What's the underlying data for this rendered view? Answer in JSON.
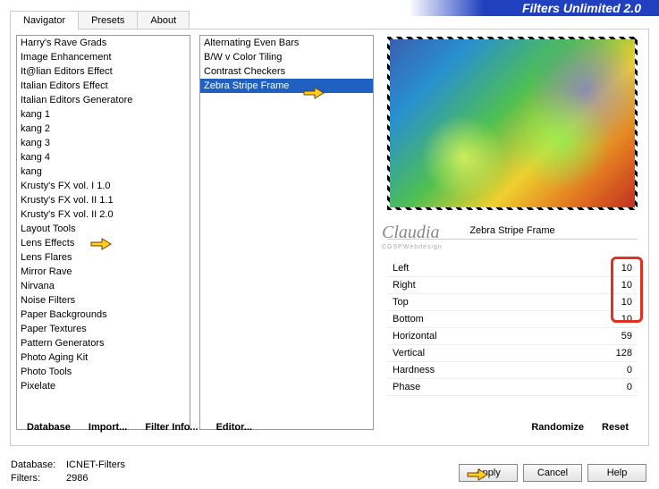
{
  "header": {
    "title": "Filters Unlimited 2.0"
  },
  "tabs": [
    "Navigator",
    "Presets",
    "About"
  ],
  "nav_items": [
    "Harry's Rave Grads",
    "Image Enhancement",
    "It@lian Editors Effect",
    "Italian Editors Effect",
    "Italian Editors Generatore",
    "kang 1",
    "kang 2",
    "kang 3",
    "kang 4",
    "kang",
    "Krusty's FX vol. I 1.0",
    "Krusty's FX vol. II 1.1",
    "Krusty's FX vol. II 2.0",
    "Layout Tools",
    "Lens Effects",
    "Lens Flares",
    "Mirror Rave",
    "Nirvana",
    "Noise Filters",
    "Paper Backgrounds",
    "Paper Textures",
    "Pattern Generators",
    "Photo Aging Kit",
    "Photo Tools",
    "Pixelate"
  ],
  "filter_items": [
    "Alternating Even Bars",
    "B/W v Color Tiling",
    "Contrast Checkers",
    "Zebra Stripe Frame"
  ],
  "filter_selected_index": 3,
  "current_filter": "Zebra Stripe Frame",
  "watermark": "Claudia",
  "watermark2": "CGSPWebdesign",
  "params": [
    {
      "name": "Left",
      "value": "10"
    },
    {
      "name": "Right",
      "value": "10"
    },
    {
      "name": "Top",
      "value": "10"
    },
    {
      "name": "Bottom",
      "value": "10"
    },
    {
      "name": "Horizontal",
      "value": "59"
    },
    {
      "name": "Vertical",
      "value": "128"
    },
    {
      "name": "Hardness",
      "value": "0"
    },
    {
      "name": "Phase",
      "value": "0"
    }
  ],
  "bottom_left": [
    "Database",
    "Import...",
    "Filter Info...",
    "Editor..."
  ],
  "bottom_right": [
    "Randomize",
    "Reset"
  ],
  "footer": {
    "db_label": "Database:",
    "db_value": "ICNET-Filters",
    "filt_label": "Filters:",
    "filt_value": "2986"
  },
  "actions": [
    "Apply",
    "Cancel",
    "Help"
  ]
}
